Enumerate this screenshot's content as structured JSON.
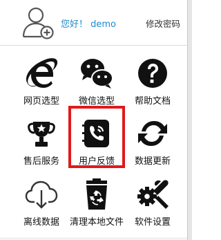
{
  "header": {
    "greeting": "您好！ demo",
    "change_password": "修改密码"
  },
  "tiles": [
    {
      "label": "网页选型",
      "icon": "ie-browser-icon"
    },
    {
      "label": "微信选型",
      "icon": "wechat-icon"
    },
    {
      "label": "帮助文档",
      "icon": "help-icon"
    },
    {
      "label": "售后服务",
      "icon": "trophy-icon"
    },
    {
      "label": "用户反馈",
      "icon": "phone-book-icon"
    },
    {
      "label": "数据更新",
      "icon": "refresh-icon"
    },
    {
      "label": "离线数据",
      "icon": "cloud-download-icon"
    },
    {
      "label": "清理本地文件",
      "icon": "recycle-bin-icon"
    },
    {
      "label": "软件设置",
      "icon": "settings-tools-icon"
    }
  ],
  "highlight_color": "#e0191b",
  "accent_color": "#1a8ccf"
}
